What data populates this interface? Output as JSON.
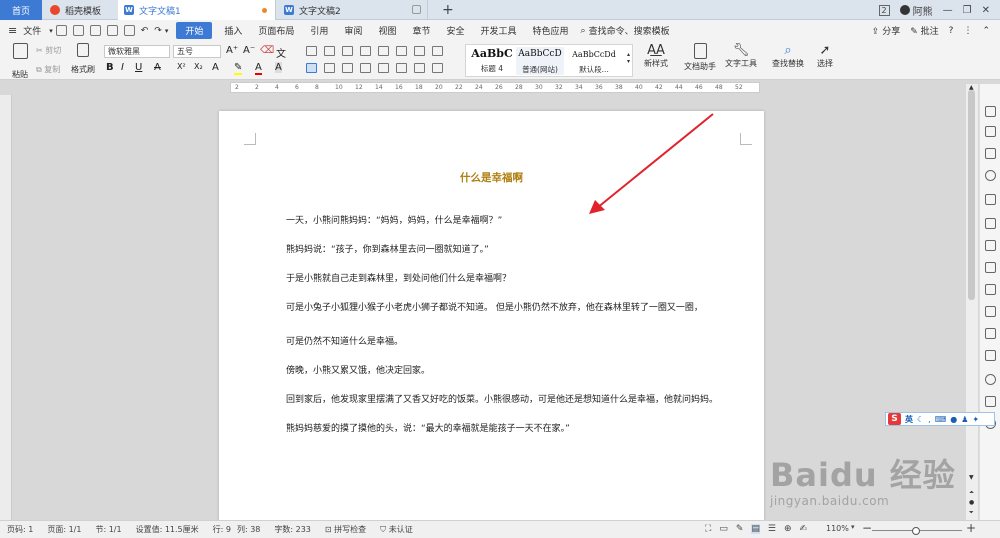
{
  "tabs": {
    "home": "首页",
    "templates": "稻壳模板",
    "doc1": "文字文稿1",
    "doc2": "文字文稿2",
    "add": "+"
  },
  "window": {
    "badge": "2",
    "user": "阿熊"
  },
  "menu": {
    "file": "文件",
    "start": "开始",
    "items": [
      "插入",
      "页面布局",
      "引用",
      "审阅",
      "视图",
      "章节",
      "安全",
      "开发工具",
      "特色应用"
    ],
    "search": "查找命令、搜索模板",
    "share": "分享",
    "comment": "批注",
    "help": "?"
  },
  "ribbon": {
    "paste": "粘贴",
    "cut": "剪切",
    "copy": "复制",
    "format_painter": "格式刷",
    "font_name": "微软雅黑",
    "font_size": "五号",
    "bold": "B",
    "italic": "I",
    "underline": "U",
    "strike": "A",
    "superscript": "X²",
    "subscript": "X₂",
    "styles": [
      {
        "preview": "AaBbC",
        "label": "标题 4"
      },
      {
        "preview": "AaBbCcD",
        "label": "普通(网站)"
      },
      {
        "preview": "AaBbCcDd",
        "label": "默认段..."
      }
    ],
    "new_style": "新样式",
    "doc_helper": "文档助手",
    "text_tools": "文字工具",
    "find_replace": "查找替换",
    "select": "选择"
  },
  "ruler": {
    "ticks": [
      "2",
      "2",
      "4",
      "6",
      "8",
      "10",
      "12",
      "14",
      "16",
      "18",
      "20",
      "22",
      "24",
      "26",
      "28",
      "30",
      "32",
      "34",
      "36",
      "38",
      "40",
      "42",
      "44",
      "46",
      "48",
      "52"
    ]
  },
  "document": {
    "title": "什么是幸福啊",
    "paragraphs": [
      "一天，小熊问熊妈妈：“妈妈，妈妈，什么是幸福啊？”",
      "熊妈妈说：“孩子，你到森林里去问一圈就知道了。”",
      "于是小熊就自己走到森林里，到处问他们什么是幸福啊？",
      "可是小兔子小狐狸小猴子小老虎小狮子都说不知道。  但是小熊仍然不放弃，他在森林里转了一圈又一圈，",
      "可是仍然不知道什么是幸福。",
      "傍晚，小熊又累又饿，他决定回家。",
      "回到家后，他发现家里摆满了又香又好吃的饭菜。小熊很感动，可是他还是想知道什么是幸福，他就问妈妈。",
      "熊妈妈慈爱的摸了摸他的头，说：“最大的幸福就是能孩子一天不在家。”"
    ]
  },
  "ime": {
    "logo": "S",
    "mode": "英"
  },
  "watermark": {
    "main": "Baidu 经验",
    "url": "jingyan.baidu.com"
  },
  "status": {
    "page_num": "页码: 1",
    "pages": "页面: 1/1",
    "section": "节: 1/1",
    "set_value": "设置值: 11.5厘米",
    "row": "行: 9",
    "col": "列: 38",
    "words": "字数: 233",
    "spell": "拼写检查",
    "cert": "未认证",
    "zoom": "110%",
    "minus": "−",
    "plus": "+"
  },
  "colors": {
    "accent": "#3c7ad4",
    "title": "#b07f12",
    "arrow": "#e0232d"
  }
}
